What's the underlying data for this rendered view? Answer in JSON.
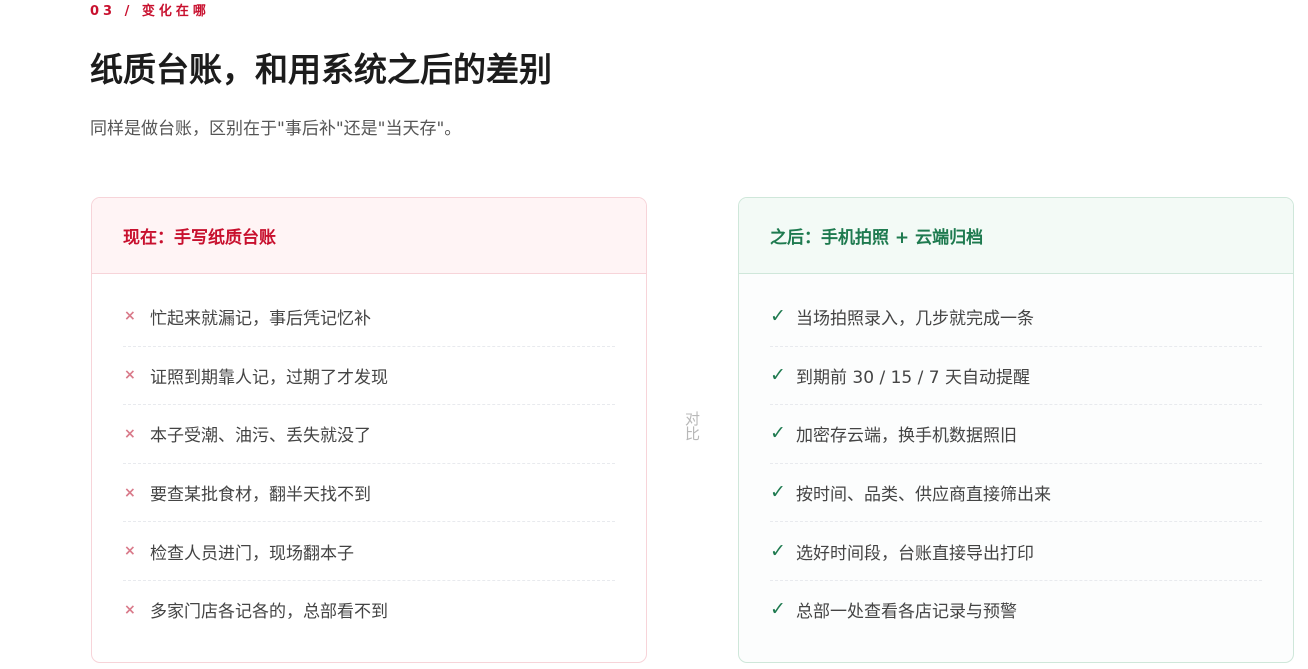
{
  "section": {
    "eyebrow": "03 / 变化在哪",
    "title": "纸质台账，和用系统之后的差别",
    "subtitle": "同样是做台账，区别在于\"事后补\"还是\"当天存\"。"
  },
  "divider_label": "对比",
  "before": {
    "title": "现在：手写纸质台账",
    "icon": "cross-icon",
    "icon_glyph": "×",
    "items": [
      "忙起来就漏记，事后凭记忆补",
      "证照到期靠人记，过期了才发现",
      "本子受潮、油污、丢失就没了",
      "要查某批食材，翻半天找不到",
      "检查人员进门，现场翻本子",
      "多家门店各记各的，总部看不到"
    ]
  },
  "after": {
    "title": "之后：手机拍照 + 云端归档",
    "icon": "check-icon",
    "icon_glyph": "✓",
    "items": [
      "当场拍照录入，几步就完成一条",
      "到期前 30 / 15 / 7 天自动提醒",
      "加密存云端，换手机数据照旧",
      "按时间、品类、供应商直接筛出来",
      "选好时间段，台账直接导出打印",
      "总部一处查看各店记录与预警"
    ]
  },
  "colors": {
    "accent_red": "#c8102e",
    "cross_pink": "#d97a8a",
    "accent_green": "#1e7a4f",
    "before_header_bg": "#fff4f5",
    "before_border": "#f7d4d9",
    "after_header_bg": "#f3faf6",
    "after_border": "#cfe7da",
    "after_body_bg": "#fcfdfd"
  }
}
